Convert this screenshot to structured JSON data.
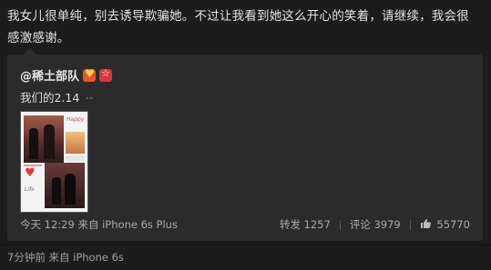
{
  "post": {
    "text": "我女儿很单纯，别去诱导欺骗她。不过让我看到她这么开心的笑着，请继续，我会很感激感谢。"
  },
  "repost": {
    "author": "@稀土部队",
    "text": "我们的2.14",
    "photo_caption_top": "Happy",
    "photo_caption_bottom": "Life",
    "time": "今天 12:29",
    "source": "来自 iPhone 6s Plus",
    "repost_label": "转发",
    "repost_count": "1257",
    "comment_label": "评论",
    "comment_count": "3979",
    "like_count": "55770"
  },
  "footer": {
    "time": "7分钟前",
    "source": "来自 iPhone 6s"
  },
  "colors": {
    "background": "#1c1c1c",
    "card": "#2b2b2b",
    "meta_text": "#a9a9a9"
  }
}
